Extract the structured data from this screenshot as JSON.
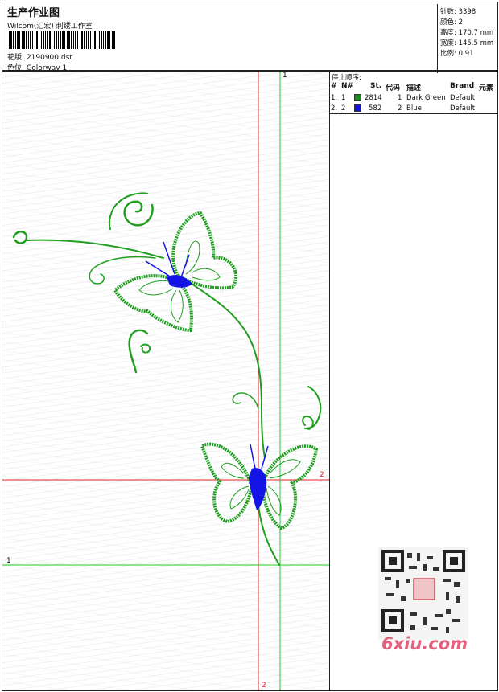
{
  "header": {
    "title": "生产作业图",
    "subtitle": "Wilcom(汇宏) 刺绣工作室",
    "design_label": "花版:",
    "design_file": "2190900.dst",
    "colorway_label": "色位:",
    "colorway": "Colorway 1"
  },
  "stats": [
    {
      "label": "针数:",
      "value": "3398"
    },
    {
      "label": "颜色:",
      "value": "2"
    },
    {
      "label": "高度:",
      "value": "170.7 mm"
    },
    {
      "label": "宽度:",
      "value": "145.5 mm"
    },
    {
      "label": "比例:",
      "value": "0.91"
    }
  ],
  "stop_sequence": {
    "title": "停止顺序:",
    "headers": [
      "#",
      "N#",
      "St.",
      "代码",
      "描述",
      "Brand",
      "元素"
    ],
    "rows": [
      {
        "num": "1.",
        "n": "1",
        "stitches": "2814",
        "code": "1",
        "description": "Dark Green",
        "brand": "Default",
        "color": "#1a8a1a"
      },
      {
        "num": "2.",
        "n": "2",
        "stitches": "582",
        "code": "2",
        "description": "Blue",
        "brand": "Default",
        "color": "#1010e0"
      }
    ]
  },
  "guides": {
    "top_label": "1",
    "left_label": "1",
    "right_label": "2",
    "bottom_label": "2"
  },
  "watermark": "6xiu.com",
  "colors": {
    "green": "#1f9e1f",
    "blue": "#1414e6",
    "red_guide": "#e02020",
    "green_guide": "#22cc22"
  }
}
